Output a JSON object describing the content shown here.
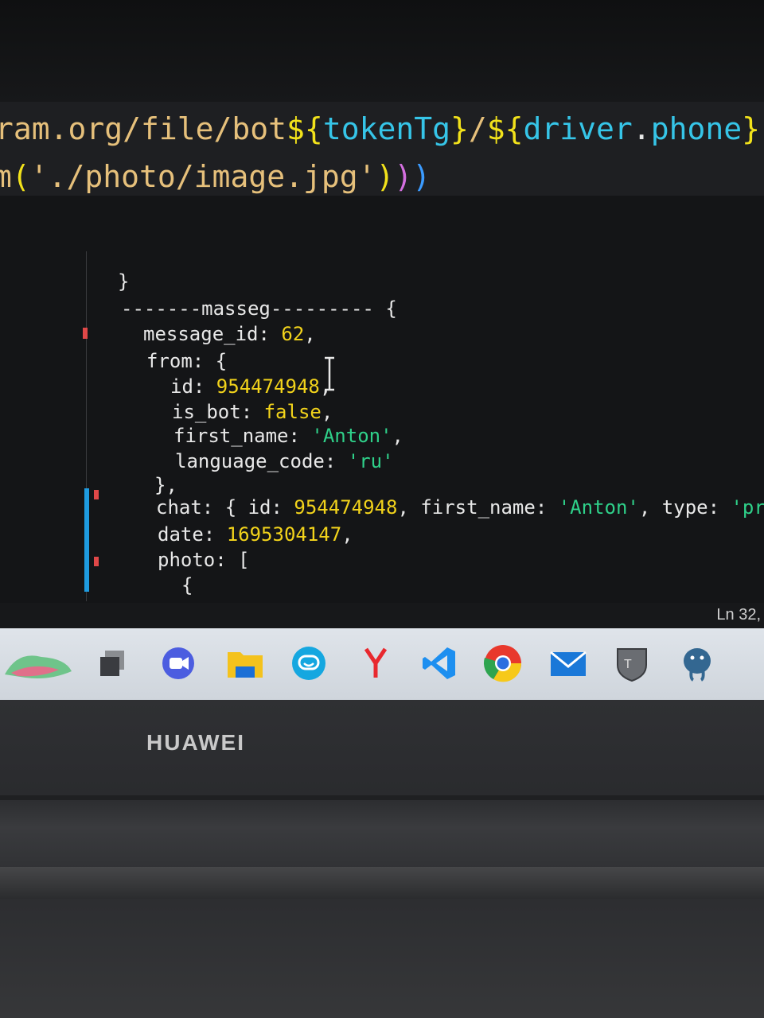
{
  "editor": {
    "line1": {
      "a": "ram.org/file/bot",
      "b": "${",
      "c": "tokenTg",
      "d": "}",
      "e": "/",
      "f": "${",
      "g": "driver",
      "h": ".",
      "i": "phone",
      "j": "}"
    },
    "line2": {
      "a": "m",
      "b": "(",
      "c": "'./photo/image.jpg'",
      "d": ")",
      "e": ")",
      "f": ")"
    }
  },
  "terminal": {
    "lines": {
      "close_brace": "}",
      "header_left": "-------masseg---------",
      "header_right": " {",
      "message_id_key": "message_id: ",
      "message_id_val": "62",
      "message_id_end": ",",
      "from_open": "from: {",
      "id_key": "id: ",
      "id_val": "954474948",
      "id_end": ",",
      "is_bot_key": "is_bot: ",
      "is_bot_val": "false",
      "is_bot_end": ",",
      "first_name_key": "first_name: ",
      "first_name_val": "'Anton'",
      "first_name_end": ",",
      "lang_key": "language_code: ",
      "lang_val": "'ru'",
      "from_close": "},",
      "chat_a": "chat: { id: ",
      "chat_id": "954474948",
      "chat_b": ", first_name: ",
      "chat_name": "'Anton'",
      "chat_c": ", type: ",
      "chat_type": "'priva",
      "date_key": "date: ",
      "date_val": "1695304147",
      "date_end": ",",
      "photo_open": "photo: [",
      "obj_open": "{"
    }
  },
  "status_bar": {
    "position": "Ln 32,"
  },
  "taskbar": {
    "icons": [
      "widgets-icon",
      "task-view-icon",
      "zoom-meet-icon",
      "file-explorer-icon",
      "chat-app-icon",
      "yandex-browser-icon",
      "vscode-icon",
      "chrome-icon",
      "mail-icon",
      "tanks-game-icon",
      "postgresql-icon"
    ]
  },
  "laptop": {
    "brand": "HUAWEI"
  },
  "colors": {
    "number": "#f2d31b",
    "string": "#2fd18a",
    "template_var": "#36c5e8",
    "template_brace": "#f2e21b"
  }
}
